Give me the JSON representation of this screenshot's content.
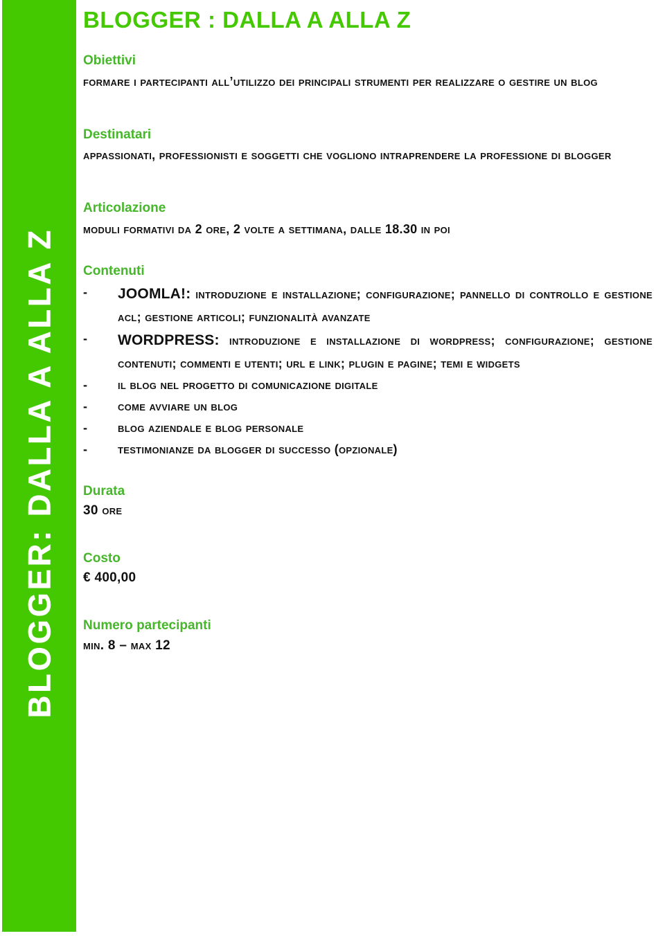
{
  "colors": {
    "band_green": "#44c800",
    "label_green": "#46b62a",
    "title_green": "#44c800",
    "text_black": "#111111",
    "band_text_white": "#ffffff"
  },
  "sidebar": {
    "vertical_title": "BLOGGER: DALLA A ALLA Z"
  },
  "document": {
    "title": "BLOGGER : DALLA A ALLA Z",
    "sections": {
      "obiettivi": {
        "label": "Obiettivi",
        "body": "Formare i partecipanti all’utilizzo dei principali strumenti per realizzare o gestire un blog"
      },
      "destinatari": {
        "label": "Destinatari",
        "body": "Appassionati, professionisti e soggetti che vogliono intraprendere la professione di Blogger"
      },
      "articolazione": {
        "label": "Articolazione",
        "body": "Moduli formativi da 2 ore, 2 volte a settimana, dalle 18.30 in poi"
      },
      "contenuti": {
        "label": "Contenuti",
        "items": [
          {
            "dash": "-",
            "lead": "JOOMLA!:",
            "rest": " introduzione e installazione; configurazione; pannello di controllo e gestione ACL; gestione articoli; funzionalità avanzate"
          },
          {
            "dash": "-",
            "lead": "WORDPRESS:",
            "rest": " introduzione e installazione di Wordpress; configurazione; gestione contenuti; commenti e utenti; URL e link; plugin e pagine; temi e widgets"
          },
          {
            "dash": "-",
            "lead": "",
            "rest": "Il blog nel progetto di comunicazione digitale"
          },
          {
            "dash": "-",
            "lead": "",
            "rest": "Come avviare un blog"
          },
          {
            "dash": "-",
            "lead": "",
            "rest": "Blog aziendale e blog personale"
          },
          {
            "dash": "-",
            "lead": "",
            "rest": "Testimonianze da blogger di successo (opzionale)"
          }
        ]
      },
      "durata": {
        "label": "Durata",
        "value": "30 ore"
      },
      "costo": {
        "label": "Costo",
        "value": "€ 400,00"
      },
      "numero_partecipanti": {
        "label": "Numero partecipanti",
        "value": "Min. 8 – max 12"
      }
    }
  }
}
